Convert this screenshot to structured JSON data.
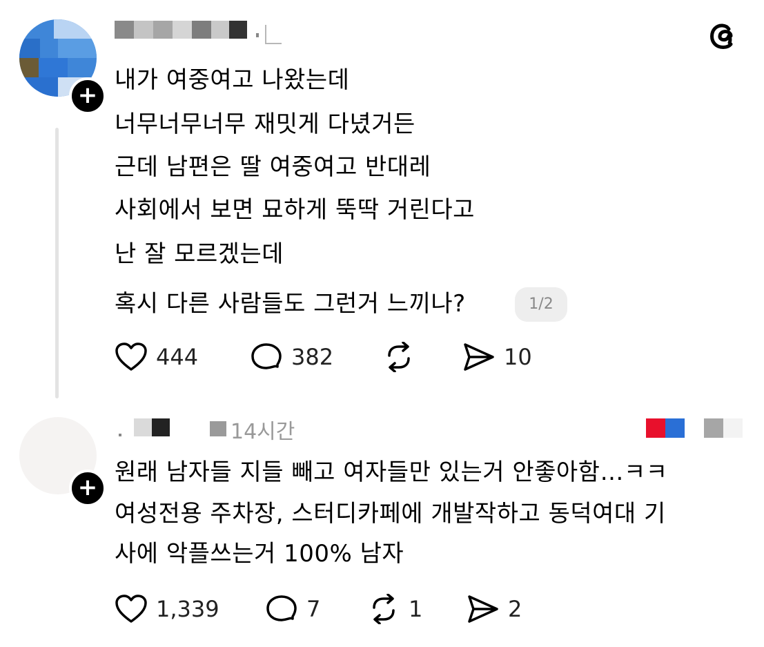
{
  "app": {
    "logo_icon": "threads-logo-icon"
  },
  "posts": [
    {
      "lines": [
        "내가 여중여고 나왔는데",
        "너무너무너무 재밋게 다녔거든",
        "근데 남편은 딸 여중여고 반대레",
        "사회에서 보면 묘하게 뚝딱 거린다고",
        "난 잘 모르겠는데",
        "혹시 다른 사람들도 그런거 느끼나?"
      ],
      "pager": "1/2",
      "likes": "444",
      "comments": "382",
      "reposts": "",
      "shares": "10"
    },
    {
      "time": "14시간",
      "lines": [
        "원래 남자들 지들 빼고 여자들만 있는거 안좋아함…ㅋㅋ",
        "여성전용 주차장, 스터디카페에 개발작하고 동덕여대 기",
        "사에 악플쓰는거 100% 남자"
      ],
      "likes": "1,339",
      "comments": "7",
      "reposts": "1",
      "shares": "2"
    }
  ],
  "colors": {
    "accent": "#000000",
    "muted": "#999999",
    "pager_bg": "#eeeeee"
  }
}
